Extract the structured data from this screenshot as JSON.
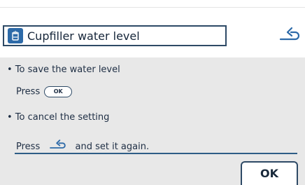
{
  "header": {
    "title": "Cupfiller water level",
    "icon": "cup-filler-icon",
    "back_icon": "back-arrow-icon"
  },
  "instructions": {
    "bullet1": "• To save the water level",
    "press1": "Press",
    "ok_key": "OK",
    "bullet2": "• To cancel the setting",
    "press2": "Press",
    "press2_suffix": "and set it again."
  },
  "ok_button": {
    "label": "OK"
  },
  "colors": {
    "accent": "#2d6aa8",
    "border": "#2e4a66",
    "panel": "#e8e8e8"
  }
}
